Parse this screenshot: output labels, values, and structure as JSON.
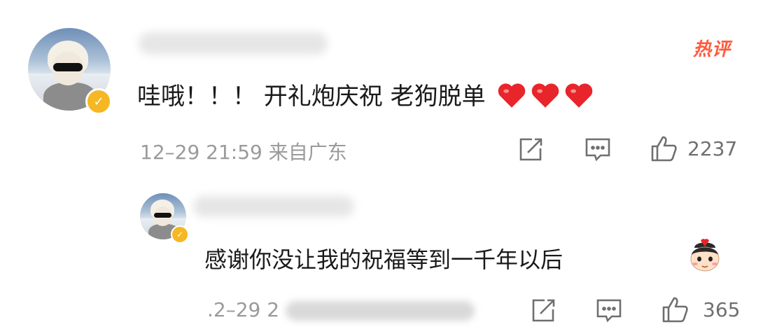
{
  "comment": {
    "hot_badge": "热评",
    "text": "哇哦！！！ 开礼炮庆祝 老狗脱单",
    "hearts": 3,
    "meta": "12–29 21:59 来自广东",
    "like_count": "2237"
  },
  "reply": {
    "text": "感谢你没让我的祝福等到一千年以后",
    "meta_visible": ".2–29 2",
    "like_count": "365"
  },
  "colors": {
    "hot": "#ff5a3d",
    "heart": "#e8252b",
    "verified": "#f5b722",
    "meta": "#9a9a9a"
  },
  "icons": [
    "repost-icon",
    "comment-icon",
    "like-icon",
    "heart-emoji",
    "face-emoji",
    "verified-badge-icon"
  ]
}
